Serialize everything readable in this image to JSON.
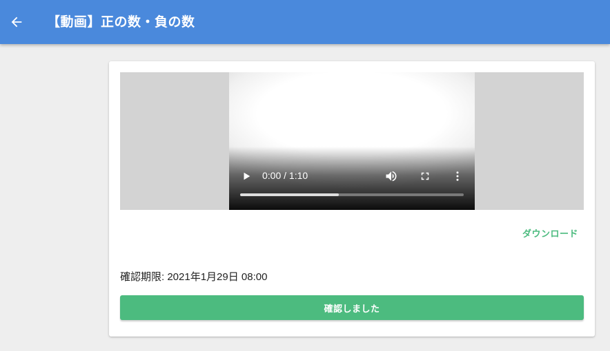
{
  "app_bar": {
    "back_icon": "arrow-left-icon",
    "title": "【動画】正の数・負の数"
  },
  "video": {
    "current_time": "0:00",
    "duration": "1:10",
    "time_display": "0:00 / 1:10",
    "buffered_fraction": 0.44,
    "icons": {
      "play": "play-icon",
      "volume": "volume-icon",
      "fullscreen": "fullscreen-icon",
      "more": "more-vert-icon"
    }
  },
  "download": {
    "label": "ダウンロード"
  },
  "deadline": {
    "text": "確認期限: 2021年1月29日 08:00"
  },
  "confirm": {
    "label": "確認しました"
  },
  "colors": {
    "app_bar": "#4a89dc",
    "accent_green": "#4cbb7f",
    "background": "#eeeeee",
    "video_letterbox": "#d3d3d3"
  }
}
